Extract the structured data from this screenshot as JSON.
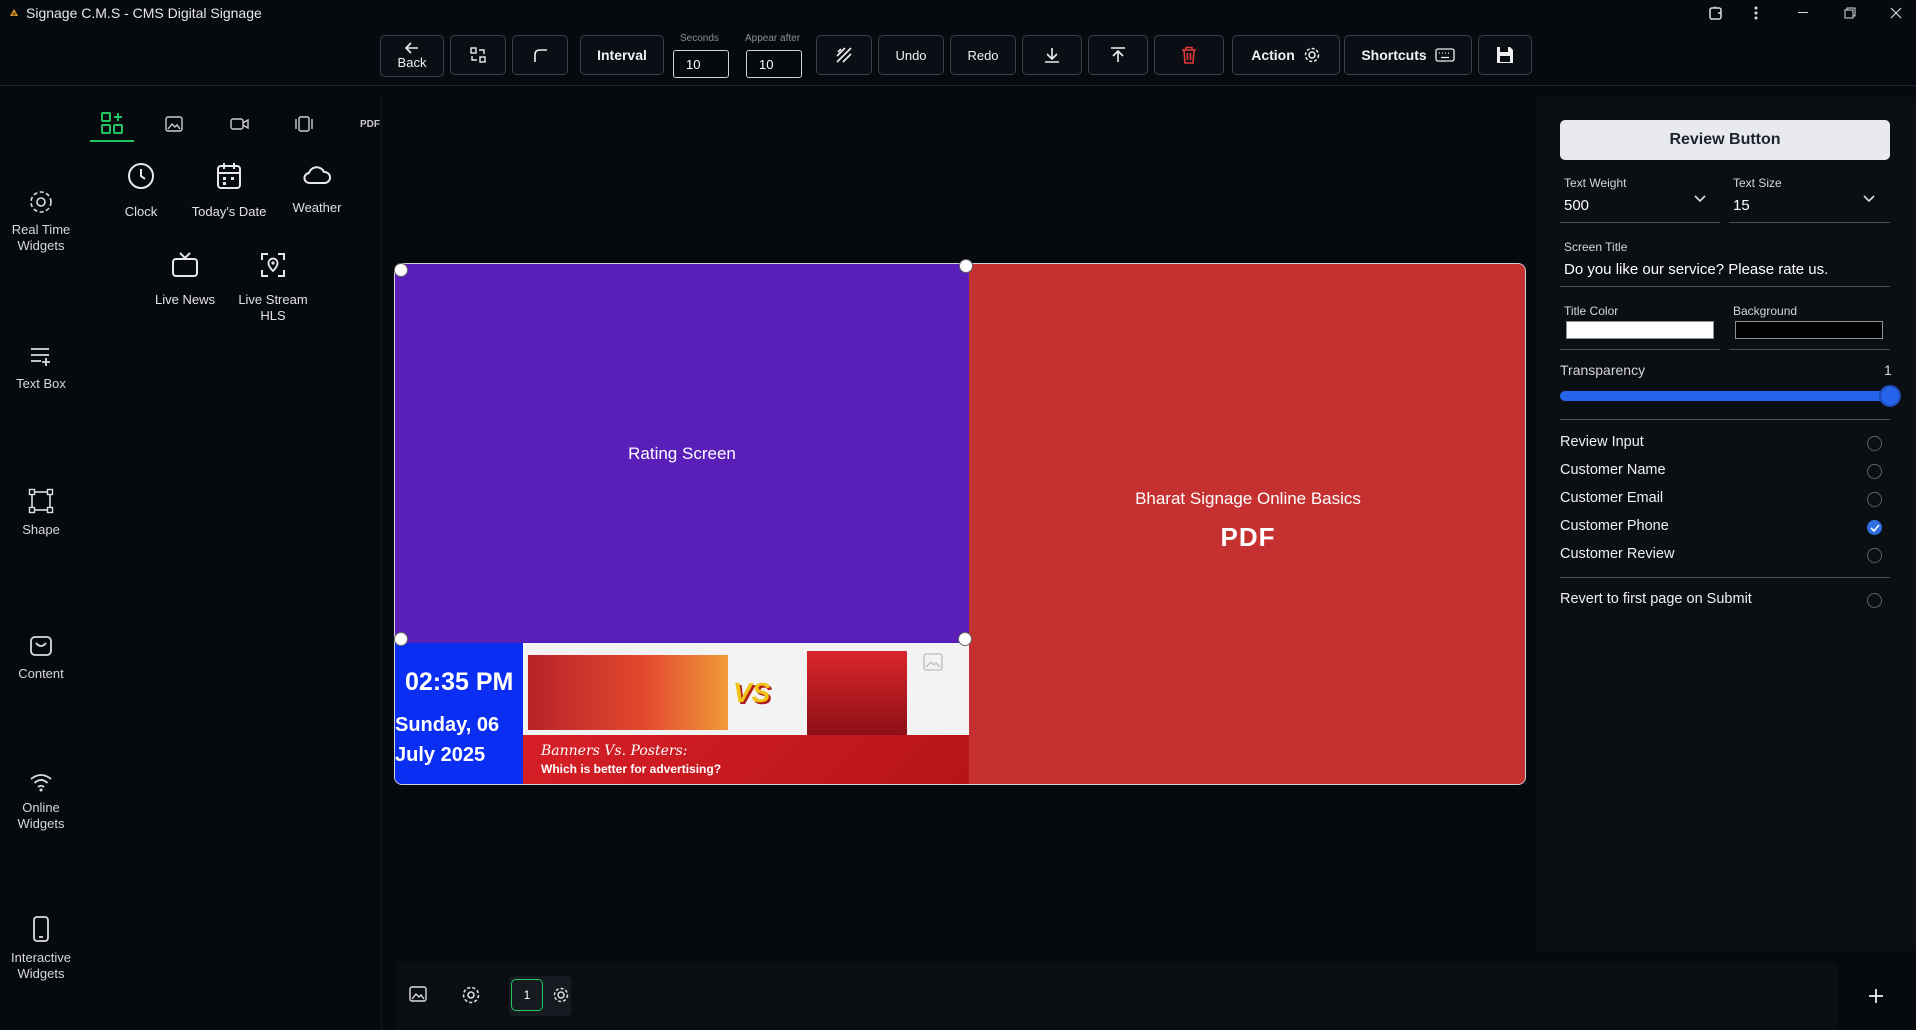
{
  "window": {
    "title": "Signage C.M.S - CMS Digital Signage"
  },
  "toolbar": {
    "back_label": "Back",
    "interval_label": "Interval",
    "seconds_label": "Seconds",
    "seconds_value": "10",
    "appear_after_label": "Appear after",
    "appear_after_value": "10",
    "undo_label": "Undo",
    "redo_label": "Redo",
    "action_label": "Action",
    "shortcuts_label": "Shortcuts"
  },
  "left_rail": {
    "items": [
      {
        "label": "Real Time Widgets",
        "icon": "realtime-icon"
      },
      {
        "label": "Text Box",
        "icon": "text-box-icon"
      },
      {
        "label": "Shape",
        "icon": "shape-icon"
      },
      {
        "label": "Content",
        "icon": "content-icon"
      },
      {
        "label": "Online Widgets",
        "icon": "wifi-icon"
      },
      {
        "label": "Interactive Widgets",
        "icon": "phone-icon"
      }
    ]
  },
  "panel": {
    "tabs": [
      "widgets",
      "image",
      "video",
      "carousel",
      "PDF",
      "layers"
    ],
    "pdf_tab_label": "PDF",
    "widgets": [
      {
        "label": "Clock",
        "icon": "clock-icon"
      },
      {
        "label": "Today's Date",
        "icon": "calendar-icon"
      },
      {
        "label": "Weather",
        "icon": "cloud-icon"
      },
      {
        "label": "Live News",
        "icon": "tv-icon"
      },
      {
        "label": "Live Stream HLS",
        "icon": "live-stream-icon"
      }
    ]
  },
  "canvas": {
    "rating_label": "Rating Screen",
    "pdf_title": "Bharat Signage Online Basics",
    "pdf_label": "PDF",
    "clock_time": "02:35 PM",
    "clock_date": "Sunday, 06 July 2025",
    "banner_vs": "VS",
    "banner_caption1": "Banners Vs. Posters:",
    "banner_caption2": "Which is better for advertising?",
    "colors": {
      "rating_bg": "#5b1fb9",
      "pdf_bg": "#c53131",
      "clock_bg": "#0a2ef2"
    }
  },
  "bottom_bar": {
    "page_number": "1"
  },
  "properties": {
    "button_title": "Review Button",
    "text_weight_label": "Text Weight",
    "text_weight_value": "500",
    "text_size_label": "Text Size",
    "text_size_value": "15",
    "screen_title_label": "Screen Title",
    "screen_title_value": "Do you like our service? Please rate us.",
    "title_color_label": "Title Color",
    "title_color_value": "#ffffff",
    "background_label": "Background",
    "background_value": "#000000",
    "transparency_label": "Transparency",
    "transparency_value": "1",
    "transparency_fraction": 1.0,
    "options": [
      {
        "label": "Review Input",
        "checked": false
      },
      {
        "label": "Customer Name",
        "checked": false
      },
      {
        "label": "Customer Email",
        "checked": false
      },
      {
        "label": "Customer Phone",
        "checked": true
      },
      {
        "label": "Customer Review",
        "checked": false
      }
    ],
    "revert_label": "Revert to first page on Submit",
    "revert_checked": false
  }
}
